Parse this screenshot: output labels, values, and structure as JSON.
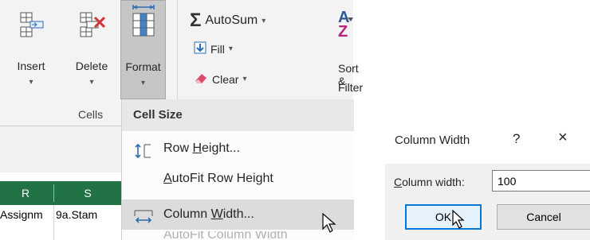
{
  "ribbon": {
    "cells_group": {
      "insert_label": "Insert",
      "delete_label": "Delete",
      "format_label": "Format",
      "group_label": "Cells"
    },
    "editing_group": {
      "autosum_label": "AutoSum",
      "fill_label": "Fill",
      "clear_label": "Clear",
      "sort_label": "Sort &",
      "filter_label": "Filter"
    }
  },
  "sheet": {
    "column_headers": [
      "R",
      "S"
    ],
    "cells": [
      "Assignm",
      "9a.Stam"
    ]
  },
  "format_menu": {
    "section_title": "Cell Size",
    "items": {
      "row_height": {
        "pre": "Row ",
        "ul": "H",
        "post": "eight..."
      },
      "autofit_row": {
        "pre": "",
        "ul": "A",
        "post": "utoFit Row Height"
      },
      "column_width": {
        "pre": "Column ",
        "ul": "W",
        "post": "idth..."
      },
      "autofit_col_partial": "AutoFit Column Width"
    }
  },
  "dialog": {
    "title": "Column Width",
    "help": "?",
    "close": "×",
    "field_label_ul": "C",
    "field_label_rest": "olumn width:",
    "field_value": "100",
    "ok_label": "OK",
    "cancel_label": "Cancel"
  },
  "colors": {
    "excel_green": "#217346",
    "dialog_accent": "#0078d7",
    "delete_red": "#d13438",
    "autosum_blue": "#2b5797"
  },
  "icons": [
    "insert-cells-icon",
    "delete-cells-icon",
    "format-cells-icon",
    "autosum-sigma-icon",
    "fill-down-icon",
    "eraser-icon",
    "sort-filter-icon",
    "row-height-icon",
    "column-width-icon",
    "mouse-pointer-icon"
  ]
}
